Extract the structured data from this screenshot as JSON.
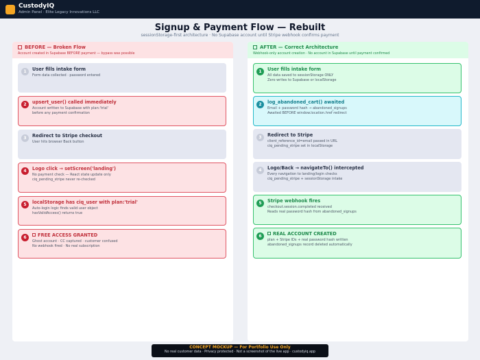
{
  "app": {
    "name": "CustodyIQ",
    "subtitle": "Admin Panel · Elite Legacy Innovations LLC"
  },
  "page": {
    "title": "Signup & Payment Flow — Rebuilt",
    "subtitle": "sessionStorage-first architecture · No Supabase account until Stripe webhook confirms payment"
  },
  "before": {
    "title": "BEFORE — Broken Flow",
    "subtitle": "Account created in Supabase BEFORE payment — bypass was possible",
    "steps": [
      {
        "num": "1",
        "title": "User fills intake form",
        "line1": "Form data collected · password entered",
        "line2": ""
      },
      {
        "num": "2",
        "title": "upsert_user() called immediately",
        "line1": "Account written to Supabase with plan:'trial'",
        "line2": "before any payment confirmation"
      },
      {
        "num": "3",
        "title": "Redirect to Stripe checkout",
        "line1": "User hits browser Back button",
        "line2": ""
      },
      {
        "num": "4",
        "title": "Logo click → setScreen('landing')",
        "line1": "No payment check — React state update only",
        "line2": "ciq_pending_stripe never re-checked"
      },
      {
        "num": "5",
        "title": "localStorage has ciq_user with plan:'trial'",
        "line1": "Auto-login logic finds valid user object",
        "line2": "hasValidAccess() returns true"
      },
      {
        "num": "6",
        "title": "FREE ACCESS GRANTED",
        "line1": "Ghost account · CC captured · customer confused",
        "line2": "No webhook fired · No real subscription"
      }
    ]
  },
  "after": {
    "title": "AFTER — Correct Architecture",
    "subtitle": "Webhook-only account creation · No account in Supabase until payment confirmed",
    "steps": [
      {
        "num": "1",
        "title": "User fills intake form",
        "line1": "All data saved to sessionStorage ONLY",
        "line2": "Zero writes to Supabase or localStorage"
      },
      {
        "num": "2",
        "title": "log_abandoned_cart() awaited",
        "line1": "Email + password hash → abandoned_signups",
        "line2": "Awaited BEFORE window.location.href redirect"
      },
      {
        "num": "3",
        "title": "Redirect to Stripe",
        "line1": "client_reference_id=email passed in URL",
        "line2": "ciq_pending_stripe set in localStorage"
      },
      {
        "num": "4",
        "title": "Logo/Back → navigateTo() intercepted",
        "line1": "Every navigation to landing/login checks",
        "line2": "ciq_pending_stripe + sessionStorage intake"
      },
      {
        "num": "5",
        "title": "Stripe webhook fires",
        "line1": "checkout.session.completed received",
        "line2": "Reads real password hash from abandoned_signups"
      },
      {
        "num": "6",
        "title": "REAL ACCOUNT CREATED",
        "line1": "plan + Stripe IDs + real password hash written",
        "line2": "abandoned_signups record deleted automatically"
      }
    ]
  },
  "footer": {
    "title": "CONCEPT MOCKUP — For Portfolio Use Only",
    "subtitle": "No real customer data · Privacy protected · Not a screenshot of the live app · custodyiq.app"
  },
  "colors": {
    "topbar": "#0f1b2d",
    "brand_accent": "#f5a623",
    "before_accent": "#c0303b",
    "before_bg": "#fde2e4",
    "after_accent": "#1e8a4b",
    "after_bg": "#dcfce7",
    "cyan_accent": "#16808f",
    "neutral_step_bg": "#e4e7f1"
  }
}
